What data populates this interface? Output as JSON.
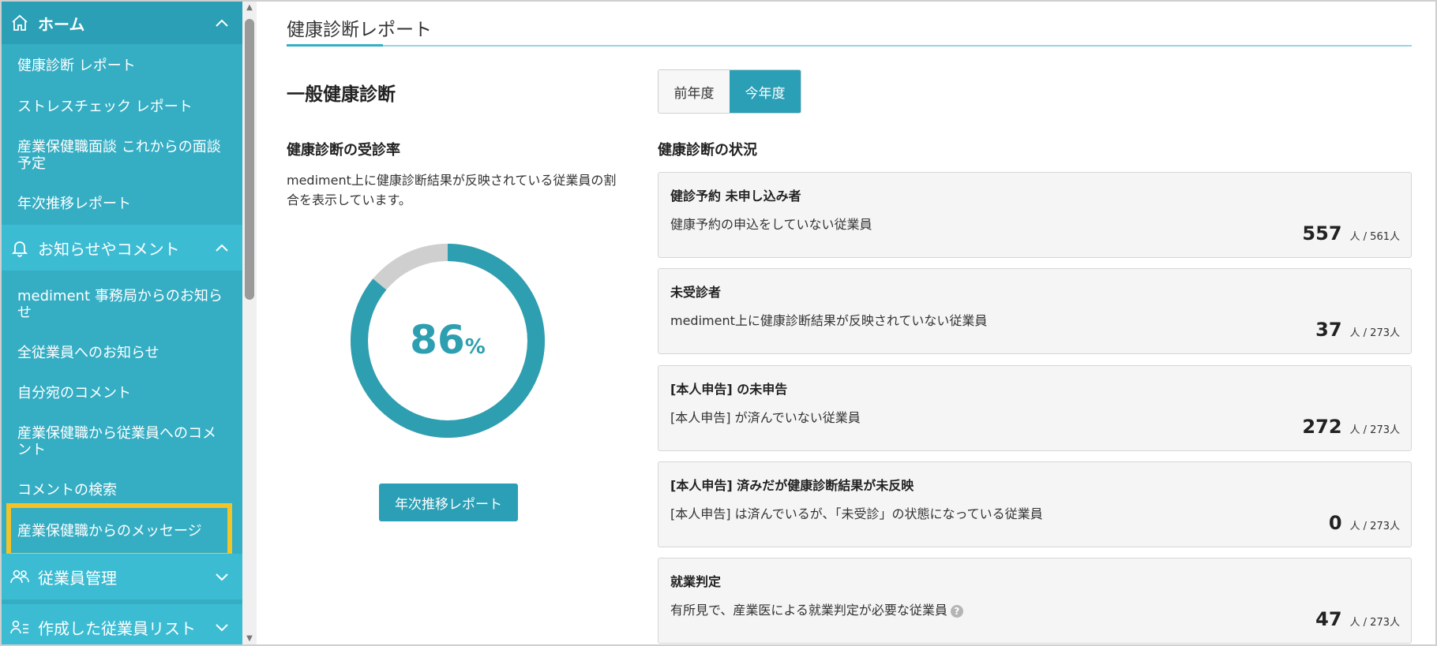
{
  "sidebar": {
    "home": {
      "label": "ホーム",
      "icon": "home-icon"
    },
    "home_items": [
      "健康診断 レポート",
      "ストレスチェック レポート",
      "産業保健職面談 これからの面談予定",
      "年次推移レポート"
    ],
    "notice": {
      "label": "お知らせやコメント",
      "icon": "bell-icon"
    },
    "notice_items": [
      "mediment 事務局からのお知らせ",
      "全従業員へのお知らせ",
      "自分宛のコメント",
      "産業保健職から従業員へのコメント",
      "コメントの検索",
      "産業保健職からのメッセージ"
    ],
    "employees": {
      "label": "従業員管理",
      "icon": "people-icon"
    },
    "employee_lists": {
      "label": "作成した従業員リスト",
      "icon": "user-list-icon"
    }
  },
  "main": {
    "page_title": "健康診断レポート",
    "section_title": "一般健康診断",
    "year_toggle": {
      "previous": "前年度",
      "current": "今年度",
      "selected": "今年度"
    },
    "rate": {
      "title": "健康診断の受診率",
      "description": "mediment上に健康診断結果が反映されている従業員の割合を表示しています。",
      "value": "86",
      "unit": "%",
      "fraction": 0.86
    },
    "annual_button": "年次推移レポート",
    "status_title": "健康診断の状況",
    "cards": [
      {
        "title": "健診予約 未申し込み者",
        "description": "健康予約の申込をしていない従業員",
        "value": "557",
        "denominator": "人 / 561人"
      },
      {
        "title": "未受診者",
        "description": "mediment上に健康診断結果が反映されていない従業員",
        "value": "37",
        "denominator": "人 / 273人"
      },
      {
        "title": "[本人申告] の未申告",
        "description": "[本人申告] が済んでいない従業員",
        "value": "272",
        "denominator": "人 / 273人"
      },
      {
        "title": "[本人申告] 済みだが健康診断結果が未反映",
        "description": "[本人申告] は済んでいるが、「未受診」の状態になっている従業員",
        "value": "0",
        "denominator": "人 / 273人"
      },
      {
        "title": "就業判定",
        "description": "有所見で、産業医による就業判定が必要な従業員",
        "value": "47",
        "denominator": "人 / 273人",
        "help_icon": "question-icon"
      }
    ]
  },
  "colors": {
    "sidebar": "#35aec4",
    "accent": "#2a9fb6",
    "donut_fill": "#2e9fb0",
    "donut_rest": "#cfcfcf",
    "highlight": "#f4c326"
  }
}
